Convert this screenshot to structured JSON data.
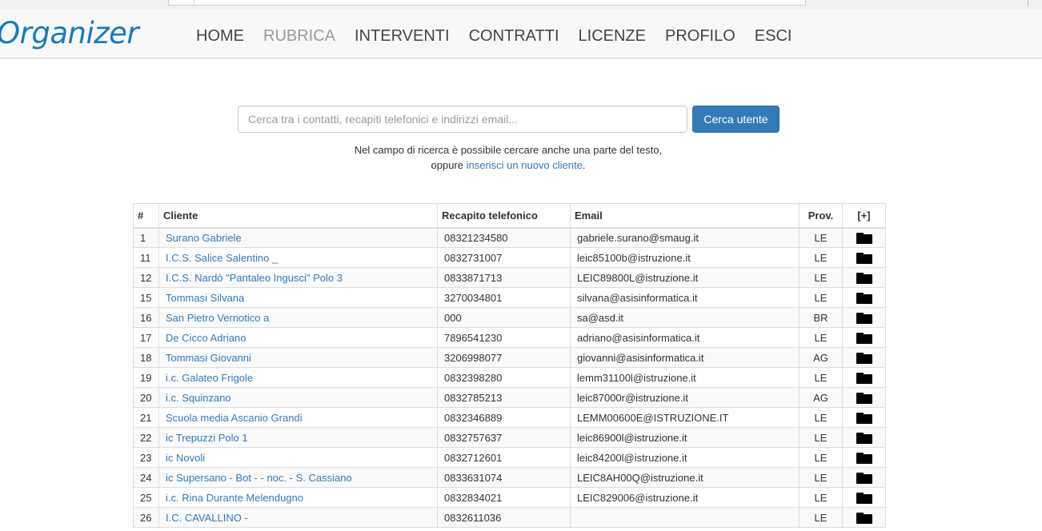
{
  "navbar": {
    "brand": "Organizer",
    "items": [
      {
        "label": "HOME",
        "active": false
      },
      {
        "label": "RUBRICA",
        "active": true
      },
      {
        "label": "INTERVENTI",
        "active": false
      },
      {
        "label": "CONTRATTI",
        "active": false
      },
      {
        "label": "LICENZE",
        "active": false
      },
      {
        "label": "PROFILO",
        "active": false
      },
      {
        "label": "ESCI",
        "active": false
      }
    ]
  },
  "search": {
    "placeholder": "Cerca tra i contatti, recapiti telefonici e indirizzi email...",
    "value": "",
    "button_label": "Cerca utente",
    "hint_line1": "Nel campo di ricerca è possibile cercare anche una parte del testo,",
    "hint_line2_prefix": "oppure ",
    "hint_link": "inserisci un nuovo cliente",
    "hint_line2_suffix": "."
  },
  "table": {
    "headers": {
      "num": "#",
      "client": "Cliente",
      "phone": "Recapito telefonico",
      "email": "Email",
      "prov": "Prov.",
      "action": "[+]"
    },
    "rows": [
      {
        "num": "1",
        "client": "Surano Gabriele",
        "phone": "08321234580",
        "email": "gabriele.surano@smaug.it",
        "prov": "LE"
      },
      {
        "num": "11",
        "client": "I.C.S. Salice Salentino _",
        "phone": "0832731007",
        "email": "leic85100b@istruzione.it",
        "prov": "LE"
      },
      {
        "num": "12",
        "client": "I.C.S. Nardò \"Pantaleo Ingusci\" Polo 3",
        "phone": "0833871713",
        "email": "LEIC89800L@istruzione.it",
        "prov": "LE"
      },
      {
        "num": "15",
        "client": "Tommasi Silvana",
        "phone": "3270034801",
        "email": "silvana@asisinformatica.it",
        "prov": "LE"
      },
      {
        "num": "16",
        "client": "San Pietro Vernotico a",
        "phone": "000",
        "email": "sa@asd.it",
        "prov": "BR"
      },
      {
        "num": "17",
        "client": "De Cicco Adriano",
        "phone": "7896541230",
        "email": "adriano@asisinformatica.it",
        "prov": "LE"
      },
      {
        "num": "18",
        "client": "Tommasi Giovanni",
        "phone": "3206998077",
        "email": "giovanni@asisinformatica.it",
        "prov": "AG"
      },
      {
        "num": "19",
        "client": "i.c. Galateo Frigole",
        "phone": "0832398280",
        "email": "lemm31100l@istruzione.it",
        "prov": "LE"
      },
      {
        "num": "20",
        "client": "i.c. Squinzano",
        "phone": "0832785213",
        "email": "leic87000r@istruzione.it",
        "prov": "AG"
      },
      {
        "num": "21",
        "client": "Scuola media Ascanio Grandi",
        "phone": "0832346889",
        "email": "LEMM00600E@ISTRUZIONE.IT",
        "prov": "LE"
      },
      {
        "num": "22",
        "client": "ic Trepuzzi Polo 1",
        "phone": "0832757637",
        "email": "leic86900l@istruzione.it",
        "prov": "LE"
      },
      {
        "num": "23",
        "client": "ic Novoli",
        "phone": "0832712601",
        "email": "leic84200l@istruzione.it",
        "prov": "LE"
      },
      {
        "num": "24",
        "client": "ic Supersano - Bot - - noc. - S. Cassiano",
        "phone": "0833631074",
        "email": "LEIC8AH00Q@istruzione.it",
        "prov": "LE"
      },
      {
        "num": "25",
        "client": "i.c. Rina Durante Melendugno",
        "phone": "0832834021",
        "email": "LEIC829006@istruzione.it",
        "prov": "LE"
      },
      {
        "num": "26",
        "client": "I.C. CAVALLINO -",
        "phone": "0832611036",
        "email": "",
        "prov": "LE"
      }
    ]
  },
  "icons": {
    "row_action": "folder-icon"
  },
  "colors": {
    "brand": "#1a7ab8",
    "link": "#337ab7",
    "primary_button": "#337ab7",
    "nav_active": "#999999",
    "nav_text": "#444444"
  }
}
